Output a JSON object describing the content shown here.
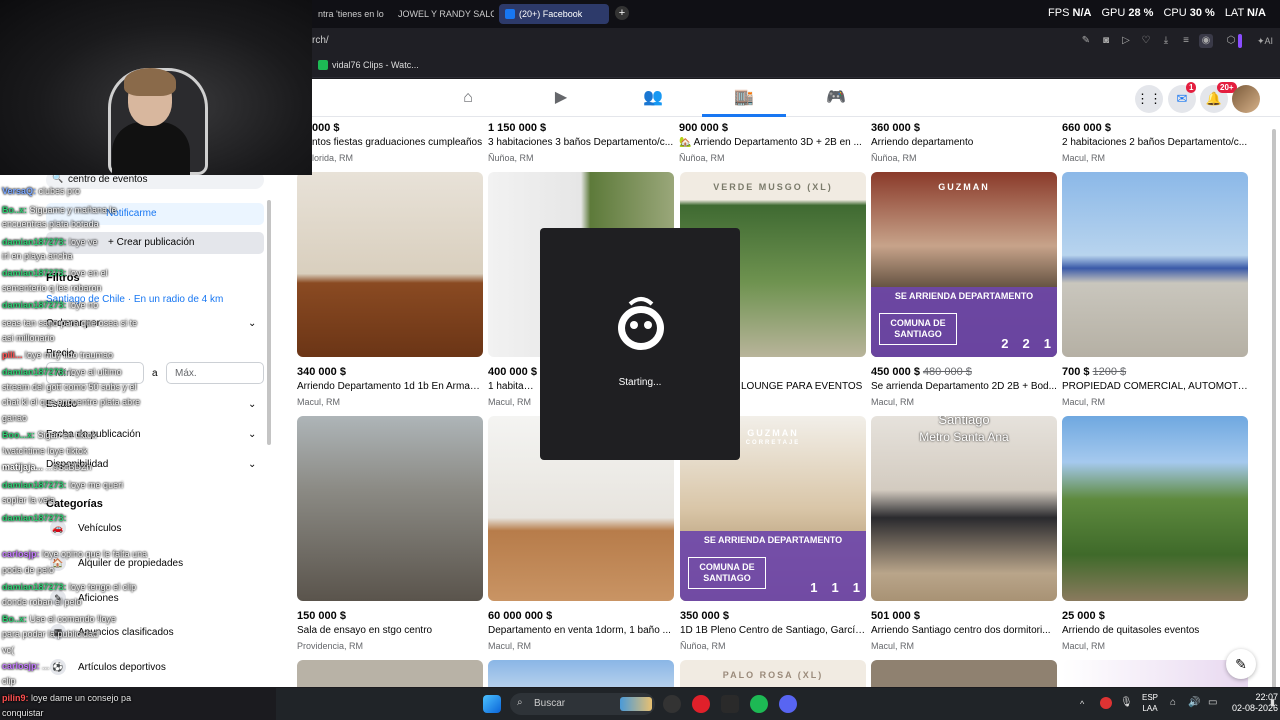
{
  "browser": {
    "tabs": [
      {
        "label": "ntra 'tienes en los o",
        "active": false
      },
      {
        "label": "JOWEL Y RANDY SALGO R",
        "active": false
      },
      {
        "label": "(20+) Facebook",
        "active": true
      }
    ],
    "url": "rch/",
    "bookmark": "vidal76 Clips - Watc...",
    "perf": {
      "fps_label": "FPS",
      "fps": "N/A",
      "gpu_label": "GPU",
      "gpu": "28 %",
      "cpu_label": "CPU",
      "cpu": "30 %",
      "lat_label": "LAT",
      "lat": "N/A"
    }
  },
  "fbnav": {
    "badges": {
      "messenger": "1",
      "notifications": "20+"
    }
  },
  "leftpanel": {
    "search_value": "centro de eventos",
    "notify_label": "Notificarme",
    "create_label": "+ Crear publicación",
    "filters_heading": "Filtros",
    "location": "Santiago de Chile · En un radio de 4 km",
    "sort_label": "Ordenar por",
    "price_label": "Precio",
    "min_placeholder": "Mín.",
    "price_sep": "a",
    "max_placeholder": "Máx.",
    "condition_label": "Estado",
    "date_label": "Fecha de publicación",
    "availability_label": "Disponibilidad",
    "categories_heading": "Categorías",
    "categories": [
      "Vehículos",
      "Alquiler de propiedades",
      "Aficiones",
      "Anuncios clasificados",
      "Artículos deportivos"
    ]
  },
  "listings": {
    "row0": [
      {
        "price": "000 $",
        "title": "ntos fiestas graduaciones cumpleaños",
        "loc": "lorida, RM"
      },
      {
        "price": "1 150 000 $",
        "title": "3 habitaciones 3 baños Departamento/c...",
        "loc": "Ñuñoa, RM"
      },
      {
        "price": "900 000 $",
        "title": "🏡 Arriendo Departamento 3D + 2B en ...",
        "loc": "Ñuñoa, RM"
      },
      {
        "price": "360 000 $",
        "title": "Arriendo departamento",
        "loc": "Ñuñoa, RM"
      },
      {
        "price": "660 000 $",
        "title": "2 habitaciones 2 baños Departamento/c...",
        "loc": "Macul, RM"
      }
    ],
    "row1": [
      {
        "price": "340 000 $",
        "old": "",
        "title": "Arriendo Departamento 1d 1b En Arman...",
        "loc": "Macul, RM"
      },
      {
        "price": "400 000 $",
        "old": "",
        "title": "1 habitación",
        "loc": "Macul, RM"
      },
      {
        "price": "",
        "old": "",
        "title": "LOUNGE PARA EVENTOS",
        "loc": ""
      },
      {
        "price": "450 000 $",
        "old": "480 000 $",
        "title": "Se arrienda Departamento 2D 2B + Bod...",
        "loc": "Macul, RM"
      },
      {
        "price": "700 $",
        "old": "1200 $",
        "title": "PROPIEDAD COMERCIAL, AUTOMOTOR...",
        "loc": "Macul, RM"
      }
    ],
    "row2": [
      {
        "price": "150 000 $",
        "title": "Sala de ensayo en stgo centro",
        "loc": "Providencia, RM"
      },
      {
        "price": "60 000 000 $",
        "title": "Departamento en venta 1dorm, 1 baño ...",
        "loc": "Macul, RM"
      },
      {
        "price": "350 000 $",
        "title": "1D 1B Pleno Centro de Santiago, García ...",
        "loc": "Ñuñoa, RM"
      },
      {
        "price": "501 000 $",
        "title": "Arriendo Santiago centro dos dormitori...",
        "loc": "Macul, RM"
      },
      {
        "price": "25 000 $",
        "title": "Arriendo de quitasoles eventos",
        "loc": "Macul, RM"
      }
    ],
    "overlays": {
      "verde": "VERDE MUSGO (XL)",
      "guzman": "GUZMAN",
      "corretaje": "CORRETAJE",
      "banner_title": "SE ARRIENDA DEPARTAMENTO",
      "banner_comuna": "COMUNA DE SANTIAGO",
      "nums_a": [
        "2",
        "2",
        "1"
      ],
      "nums_b": [
        "1",
        "1",
        "1"
      ],
      "santiago": "Santiago",
      "metro": "Metro Santa Ana",
      "palo": "PALO ROSA (XL)"
    }
  },
  "modal": {
    "text": "Starting..."
  },
  "chat": [
    {
      "user": "VersaQ:",
      "msg": " clubes pro",
      "color": "#7aa7ff"
    },
    {
      "user": "Bo..x:",
      "msg": " Siguame y mañana le",
      "color": "#2ecc71"
    },
    {
      "user": "",
      "msg": "encuentras plata botada",
      "color": ""
    },
    {
      "user": "damian187273:",
      "msg": " loye ve",
      "color": "#2ecc71"
    },
    {
      "user": "",
      "msg": "irl en playa ancha",
      "color": ""
    },
    {
      "user": "damian187273:",
      "msg": " loye en el",
      "color": "#2ecc71"
    },
    {
      "user": "",
      "msg": "sementerio q les robaron",
      "color": ""
    },
    {
      "user": "damian187273:",
      "msg": " loye no",
      "color": "#2ecc71"
    },
    {
      "user": "",
      "msg": "seas tan sapo para que osea si te",
      "color": ""
    },
    {
      "user": "",
      "msg": "asi millonario",
      "color": ""
    },
    {
      "user": "pili...",
      "msg": " loye muy lido traumao",
      "color": "#ff5050"
    },
    {
      "user": "damian187273:",
      "msg": " loye al ultimo",
      "color": "#2ecc71"
    },
    {
      "user": "",
      "msg": "stream del gott como 50 subs y el",
      "color": ""
    },
    {
      "user": "",
      "msg": "chat kl el que encuentre plata abre",
      "color": ""
    },
    {
      "user": "",
      "msg": "ganao",
      "color": ""
    },
    {
      "user": "Boo...x:",
      "msg": " Sigan en tiktok",
      "color": "#2ecc71"
    },
    {
      "user": "",
      "msg": "!watchtime loye tiktok",
      "color": ""
    },
    {
      "user": "matijaja...",
      "msg": " ...9ScBDZn",
      "color": "#fff"
    },
    {
      "user": "damian187273:",
      "msg": " loye me queri",
      "color": "#2ecc71"
    },
    {
      "user": "",
      "msg": "soplar la vela",
      "color": ""
    },
    {
      "user": "damian187273:",
      "msg": "",
      "color": "#2ecc71"
    },
    {
      "user": "carlosjp:",
      "msg": " loye opino que le falta una",
      "color": "#c478ff"
    },
    {
      "user": "",
      "msg": "poda de pelo",
      "color": ""
    },
    {
      "user": "damian187273:",
      "msg": " loye tengo el clip",
      "color": "#2ecc71"
    },
    {
      "user": "",
      "msg": "donde roban el pelo",
      "color": ""
    },
    {
      "user": "Bo..x:",
      "msg": " Use el comando !loye",
      "color": "#2ecc71"
    },
    {
      "user": "",
      "msg": "para podar la publicidad",
      "color": ""
    },
    {
      "user": "",
      "msg": "vc(",
      "color": ""
    },
    {
      "user": "carlosjp:",
      "msg": " ...",
      "color": "#c478ff"
    },
    {
      "user": "",
      "msg": "clip",
      "color": ""
    },
    {
      "user": "pilin9:",
      "msg": " loye dame un consejo pa",
      "color": "#ff5050"
    },
    {
      "user": "",
      "msg": "conquistar",
      "color": ""
    }
  ],
  "taskbar": {
    "search_placeholder": "Buscar",
    "lang": "ESP",
    "lang2": "LAA",
    "time": "22:07",
    "date": "02-08-2026"
  },
  "colors": {
    "fb_blue": "#1877f2",
    "banner_purple": "#6e46aa",
    "taskbar": "#202428"
  }
}
